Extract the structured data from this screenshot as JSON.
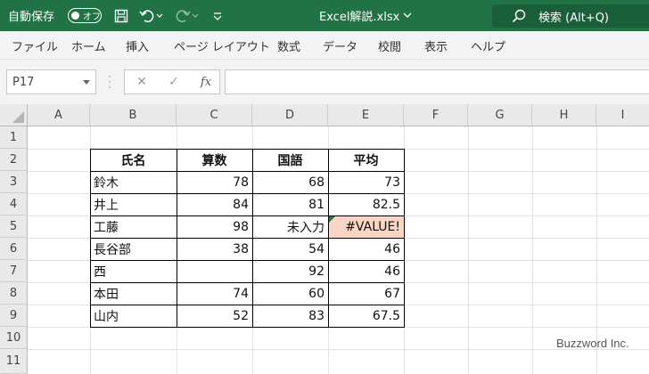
{
  "titlebar": {
    "autosave_label": "自動保存",
    "toggle_text": "オフ",
    "filename": "Excel解説.xlsx",
    "search_label": "検索 (Alt+Q)",
    "bg_color": "#217346"
  },
  "ribbon": {
    "tabs": [
      "ファイル",
      "ホーム",
      "挿入",
      "ページ レイアウト",
      "数式",
      "データ",
      "校閲",
      "表示",
      "ヘルプ"
    ]
  },
  "formula_bar": {
    "name_box": "P17",
    "fx_label": "fx",
    "value": ""
  },
  "sheet": {
    "columns": [
      "A",
      "B",
      "C",
      "D",
      "E",
      "F",
      "G",
      "H",
      "I"
    ],
    "rows": [
      "1",
      "2",
      "3",
      "4",
      "5",
      "6",
      "7",
      "8",
      "9",
      "10",
      "11"
    ],
    "table": {
      "headers": [
        "氏名",
        "算数",
        "国語",
        "平均"
      ],
      "rows": [
        [
          "鈴木",
          "78",
          "68",
          "73"
        ],
        [
          "井上",
          "84",
          "81",
          "82.5"
        ],
        [
          "工藤",
          "98",
          "未入力",
          "#VALUE!"
        ],
        [
          "長谷部",
          "38",
          "54",
          "46"
        ],
        [
          "西",
          "",
          "92",
          "46"
        ],
        [
          "本田",
          "74",
          "60",
          "67"
        ],
        [
          "山内",
          "52",
          "83",
          "67.5"
        ]
      ]
    },
    "error_fill_color": "#fbd5c4"
  },
  "watermark": "Buzzword Inc."
}
